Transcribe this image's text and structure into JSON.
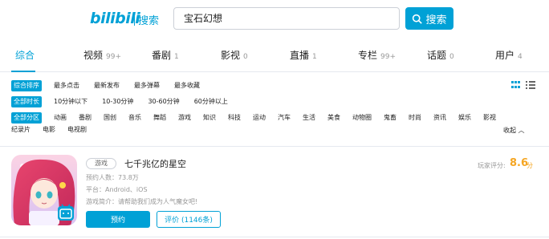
{
  "header": {
    "logo": "bilibili",
    "logo_sub": "搜索",
    "search_value": "宝石幻想",
    "search_button": "搜索"
  },
  "tabs": [
    {
      "label": "综合",
      "count": ""
    },
    {
      "label": "视频",
      "count": "99+"
    },
    {
      "label": "番剧",
      "count": "1"
    },
    {
      "label": "影视",
      "count": "0"
    },
    {
      "label": "直播",
      "count": "1"
    },
    {
      "label": "专栏",
      "count": "99+"
    },
    {
      "label": "话题",
      "count": "0"
    },
    {
      "label": "用户",
      "count": "4"
    }
  ],
  "filters": {
    "sort": [
      "综合排序",
      "最多点击",
      "最新发布",
      "最多弹幕",
      "最多收藏"
    ],
    "duration": [
      "全部时长",
      "10分钟以下",
      "10-30分钟",
      "30-60分钟",
      "60分钟以上"
    ],
    "category_row1": [
      "全部分区",
      "动画",
      "番剧",
      "国创",
      "音乐",
      "舞蹈",
      "游戏",
      "知识",
      "科技",
      "运动",
      "汽车",
      "生活",
      "美食",
      "动物圈",
      "鬼畜",
      "时尚",
      "资讯",
      "娱乐",
      "影视"
    ],
    "category_row2": [
      "纪录片",
      "电影",
      "电视剧"
    ],
    "collapse": "收起"
  },
  "result": {
    "tag": "游戏",
    "title": "七千兆亿的星空",
    "reservations": "预约人数：73.8万",
    "platform": "平台：Android、iOS",
    "intro": "游戏简介：请帮助我们成为人气魔女吧!",
    "rating_label": "玩家评分:",
    "rating_value": "8.6",
    "rating_unit": "分",
    "reserve_button": "预约",
    "review_button": "评价 (1146条)"
  },
  "colors": {
    "accent": "#00a1d6",
    "rating": "#f5a623"
  }
}
